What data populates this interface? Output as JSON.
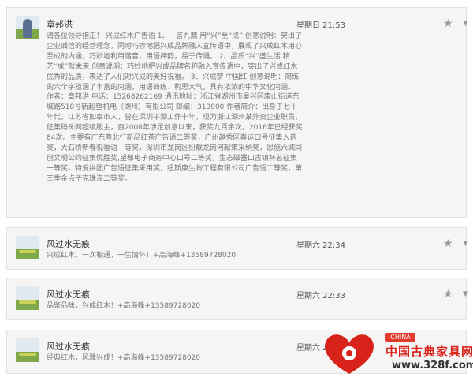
{
  "messages": [
    {
      "author": "章邦洪",
      "time": "星期日 21:53",
      "avatar_icon": "avatar-photo-person",
      "text": "请各位领导指正！ 兴成红木广告语 1、一言九鼎  用“兴”至“成” 创意说明：突出了企业诚信的经营理念，同时巧妙地把兴成品牌融入宣传语中，展现了兴成红木用心至成的内涵，巧妙地利用谐音，用语押韵，易于传诵。 2、品质“兴”盛生活  精艺“成”就未来 创意说明：巧妙地把兴成品牌名称融入宣传语中，突出了兴成红木优秀的品质，表达了人们对兴成的美好祝福。 3、兴成梦  中国红 创意说明：简练的六个字蕴涵了丰富的内涵，用语简练、构思大气，具有浓浓的中华文化内涵。 作者：章邦洪 电话：15268262169 通讯地址：浙江省湖州市吴兴区康山街道东城路518号新超塑机电（湖州）有限公司 邮编：313000 作者简介：出身于七十年代，江苏省如皋市人，曾在深圳平湖工作十年，现为浙江湖州某外资企业职员，征集码头网超级版主，自2008年涉足创意以来，获奖九百余次。2016年已经获奖84次。主要有广东粤北行新品红茶广告语二等奖，广州越秀区春运口号征集入选奖，大石桥新春祝福语一等奖，深圳市龙岗区扮靓龙岗河献策采纳奖，恩施六城同创文明公约征集优胜奖,望都电子商务中心口号二等奖，生态磁器口古镇杯名征集一等奖，特爱拼团广告语征集采用奖，纽斯康生物工程有限公司广告语二等奖，第三季金点子克珠海二等奖。"
    },
    {
      "author": "风过水无痕",
      "time": "星期六 22:34",
      "avatar_icon": "avatar-photo-landscape",
      "text": "兴成红木，一次相遇，一生情怀！+高海峰+13589728020"
    },
    {
      "author": "风过水无痕",
      "time": "星期六 22:33",
      "avatar_icon": "avatar-photo-landscape",
      "text": "品鉴品味，兴成红木！+高海峰+13589728020"
    },
    {
      "author": "风过水无痕",
      "time": "星期六 22:2",
      "avatar_icon": "avatar-photo-landscape",
      "text": "经典红木，风雅兴成！+高海峰+13589728020"
    }
  ],
  "actions": {
    "star_glyph": "★",
    "more_glyph": "▼"
  },
  "watermark": {
    "badge": "CHINA",
    "title": "中国古典家具网",
    "url": "www.328f.com",
    "color": "#d8231a"
  },
  "colors": {
    "card_bg": "#f5f5f5",
    "border": "#e2e2e2",
    "body_text": "#777777"
  }
}
